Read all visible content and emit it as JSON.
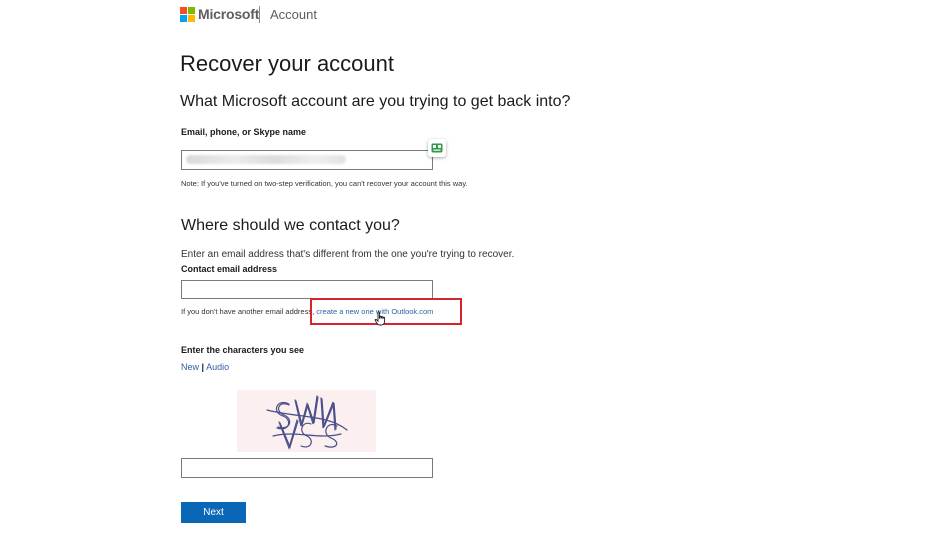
{
  "header": {
    "brand": "Microsoft",
    "section": "Account",
    "logo_colors": [
      "#f25022",
      "#7fba00",
      "#00a4ef",
      "#ffb900"
    ]
  },
  "page_title": "Recover your account",
  "account_section": {
    "heading": "What Microsoft account are you trying to get back into?",
    "field_label": "Email, phone, or Skype name",
    "field_value_redacted": true,
    "note": "Note: If you've turned on two-step verification, you can't recover your account this way."
  },
  "contact_section": {
    "heading": "Where should we contact you?",
    "instruction": "Enter an email address that's different from the one you're trying to recover.",
    "field_label": "Contact email address",
    "field_value": "",
    "hint_prefix": "If you don't have another email address,",
    "hint_link": "create a new one with Outlook.com"
  },
  "captcha": {
    "label": "Enter the characters you see",
    "new_link": "New",
    "separator": "|",
    "audio_link": "Audio",
    "input_value": ""
  },
  "actions": {
    "next_label": "Next"
  },
  "colors": {
    "accent_blue": "#0a67b8",
    "link_blue": "#2f5fa7",
    "highlight_red": "#d9242b"
  }
}
